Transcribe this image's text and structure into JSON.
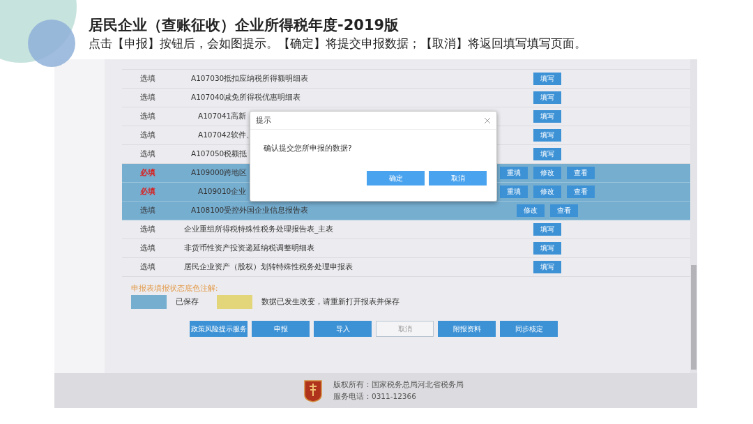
{
  "slide": {
    "title": "居民企业（查账征收）企业所得税年度-2019版",
    "subtitle": "点击【申报】按钮后，会如图提示。【确定】将提交申报数据；【取消】将返回填写填写页面。"
  },
  "table": {
    "rows": [
      {
        "kind": "coded",
        "requirement": "选填",
        "required": false,
        "name": "A107030抵扣应纳税所得额明细表",
        "saved": false,
        "actions": [
          "填写"
        ]
      },
      {
        "kind": "coded",
        "requirement": "选填",
        "required": false,
        "name": "A107040减免所得税优惠明细表",
        "saved": false,
        "actions": [
          "填写"
        ],
        "children": [
          {
            "kind": "coded",
            "requirement": "选填",
            "required": false,
            "name": "A107041高新",
            "saved": false,
            "actions": [
              "填写"
            ]
          },
          {
            "kind": "coded",
            "requirement": "选填",
            "required": false,
            "name": "A107042软件、",
            "saved": false,
            "actions": [
              "填写"
            ]
          }
        ]
      },
      {
        "kind": "coded",
        "requirement": "选填",
        "required": false,
        "name": "A107050税额抵",
        "saved": false,
        "actions": [
          "填写"
        ]
      },
      {
        "kind": "coded",
        "requirement": "必填",
        "required": true,
        "name": "A109000跨地区",
        "saved": true,
        "actions": [
          "重填",
          "修改",
          "查看"
        ],
        "children": [
          {
            "kind": "coded",
            "requirement": "必填",
            "required": true,
            "name": "A109010企业",
            "saved": true,
            "actions": [
              "重填",
              "修改",
              "查看"
            ]
          }
        ]
      },
      {
        "kind": "coded",
        "requirement": "选填",
        "required": false,
        "name": "A108100受控外国企业信息报告表",
        "saved": true,
        "actions": [
          "修改",
          "查看"
        ]
      },
      {
        "kind": "plain",
        "requirement": "选填",
        "required": false,
        "name": "企业重组所得税特殊性税务处理报告表_主表",
        "saved": false,
        "actions": [
          "填写"
        ]
      },
      {
        "kind": "plain",
        "requirement": "选填",
        "required": false,
        "name": "非货币性资产投资递延纳税调整明细表",
        "saved": false,
        "actions": [
          "填写"
        ]
      },
      {
        "kind": "plain",
        "requirement": "选填",
        "required": false,
        "name": "居民企业资产（股权）划转特殊性税务处理申报表",
        "saved": false,
        "actions": [
          "填写"
        ]
      }
    ]
  },
  "legend": {
    "title": "申报表填报状态底色注解:",
    "items": [
      {
        "color": "#76aed0",
        "label": "已保存"
      },
      {
        "color": "#e2d57a",
        "label": "数据已发生改变，请重新打开报表并保存"
      }
    ]
  },
  "buttons": [
    {
      "label": "政策风险提示服务",
      "kind": "primary"
    },
    {
      "label": "申报",
      "kind": "primary"
    },
    {
      "label": "导入",
      "kind": "primary"
    },
    {
      "label": "取消",
      "kind": "outline"
    },
    {
      "label": "附报资料",
      "kind": "primary"
    },
    {
      "label": "同步核定",
      "kind": "primary"
    }
  ],
  "dialog": {
    "title": "提示",
    "message": "确认提交您所申报的数据?",
    "buttons": [
      "确定",
      "取消"
    ]
  },
  "footer": {
    "lines": [
      "版权所有：国家税务总局河北省税务局",
      "服务电话：0311-12366"
    ]
  }
}
